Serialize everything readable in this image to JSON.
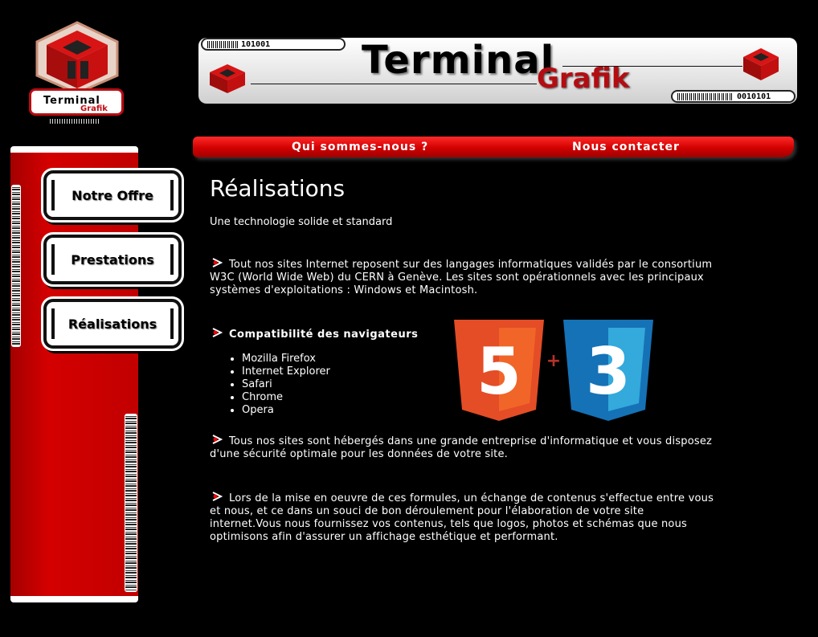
{
  "logo": {
    "word1": "Terminal",
    "word2": "Grafik"
  },
  "banner": {
    "title1": "Terminal",
    "title2": "Grafik",
    "barcode_left": "101001",
    "barcode_right": "0010101"
  },
  "topnav": [
    {
      "label": "Qui sommes-nous ?"
    },
    {
      "label": "Nous contacter"
    }
  ],
  "sidebar": [
    {
      "label": "Notre Offre"
    },
    {
      "label": "Prestations"
    },
    {
      "label": "Réalisations"
    }
  ],
  "content": {
    "title": "Réalisations",
    "subtitle": "Une technologie solide et standard",
    "p1": "Tout nos sites Internet reposent sur des langages informatiques validés par le consortium W3C (World Wide Web) du CERN à Genève. Les sites sont opérationnels avec les principaux systèmes d'exploitations : Windows et Macintosh.",
    "compat_title": "Compatibilité des navigateurs",
    "browsers": [
      "Mozilla Firefox",
      "Internet Explorer",
      "Safari",
      "Chrome",
      "Opera"
    ],
    "p2": "Tous nos sites sont hébergés dans une grande entreprise d'informatique et vous disposez d'une sécurité optimale pour les données de votre site.",
    "p3": "Lors de la mise en oeuvre de ces formules, un échange de contenus s'effectue entre vous et nous, et ce dans un souci de bon déroulement pour l'élaboration de votre site internet.Vous nous fournissez vos contenus, tels que logos, photos et schémas que nous optimisons afin d'assurer un affichage esthétique et performant."
  },
  "tech_logos": {
    "html_digit": "5",
    "plus": "+",
    "css_digit": "3"
  },
  "colors": {
    "red": "#d20000",
    "html_orange": "#e44d26",
    "css_blue": "#1572b6"
  }
}
